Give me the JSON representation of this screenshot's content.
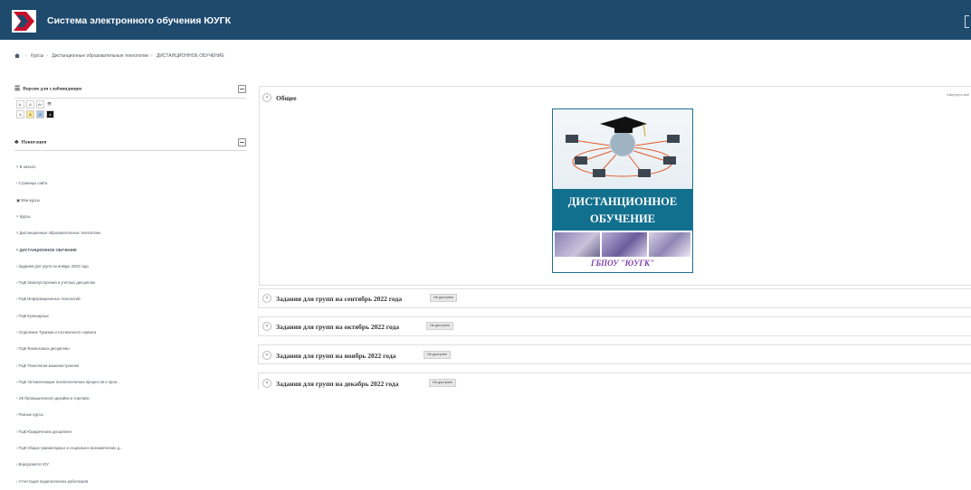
{
  "header": {
    "site_title": "Система электронного обучения ЮУГК"
  },
  "breadcrumb": [
    "Курсы",
    "Дистанционные образовательные технологии",
    "ДИСТАНЦИОННОЕ ОБУЧЕНИЕ"
  ],
  "accessibility_block": {
    "title": "Версия для слабовидящих",
    "row1": [
      "A-",
      "A",
      "A+",
      "👁"
    ],
    "row2": [
      "A",
      "A",
      "A",
      "A"
    ]
  },
  "navigation_block": {
    "title": "Навигация",
    "items": [
      "˅ В начало",
      "  › Страницы сайта",
      "  ▣ Мои курсы",
      "˅ Курсы",
      "    ˅ Дистанционные образовательные технологии",
      "        ˅ ДИСТАНЦИОННОЕ ОБУЧЕНИЕ",
      "            › Задания для групп на январь 2023 года",
      "    › ПЦК Землеустроения и учетных дисциплин",
      "    › ПЦК Информационных технологий",
      "    › ПЦК Кулинарных",
      "    › Отделение Туризма и гостиничного сервиса",
      "    › ПЦК Финансовых дисциплин",
      "    › ПЦК Технологии машиностроения",
      "    › ПЦК Автоматизации технологических процессов и прои...",
      "    › ЭК Промышленного дизайна и торговли",
      "    › Разные курсы",
      "    › ПЦК Юридических дисциплин",
      "    › ПЦК Общих гуманитарных и социально-экономических д...",
      "    › Ворлдскиллс ЮУ",
      "    › Аттестация педагогических работников"
    ]
  },
  "main": {
    "general_title": "Общее",
    "collapse_all": "Свернуть всё",
    "course_image": {
      "line1": "ДИСТАНЦИОННОЕ",
      "line2": "ОБУЧЕНИЕ",
      "caption": "ГБПОУ \"ЮУГК\""
    },
    "sections": [
      {
        "title": "Задания для групп на сентябрь 2022 года",
        "badge": "Не доступен"
      },
      {
        "title": "Задания для групп на октябрь 2022 года",
        "badge": "Не доступен"
      },
      {
        "title": "Задания для групп на ноябрь 2022 года",
        "badge": "Не доступен"
      },
      {
        "title": "Задания для групп на декабрь 2022 года",
        "badge": "Не доступен"
      }
    ]
  },
  "icons": {
    "home": "home-icon",
    "menu": "menu-icon",
    "sitemap": "sitemap-icon",
    "chevron": "chevron-down-icon"
  }
}
